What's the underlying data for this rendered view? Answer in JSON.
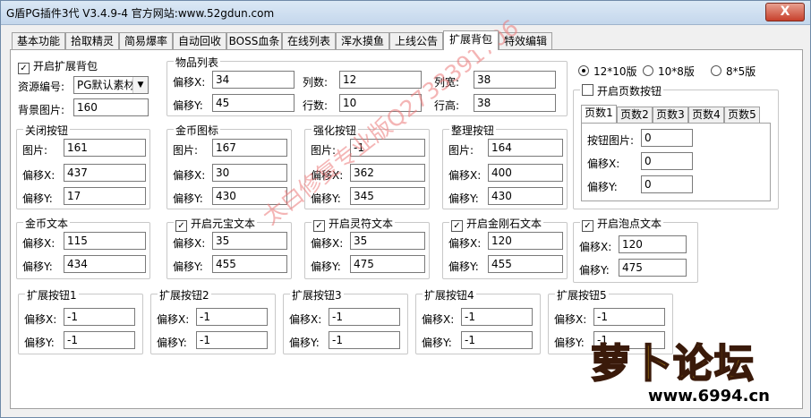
{
  "window": {
    "title": "G盾PG插件3代  V3.4.9-4   官方网站:www.52gdun.com",
    "close_label": "X"
  },
  "tabs": [
    "基本功能",
    "拾取精灵",
    "简易爆率",
    "自动回收",
    "BOSS血条",
    "在线列表",
    "浑水摸鱼",
    "上线公告",
    "扩展背包",
    "特效编辑"
  ],
  "active_tab": "扩展背包",
  "left": {
    "enable_label": "开启扩展背包",
    "enable_checked": true,
    "resource_label": "资源编号:",
    "resource_value": "PG默认素材",
    "bg_label": "背景图片:",
    "bg_value": "160"
  },
  "item_list": {
    "title": "物品列表",
    "offx_label": "偏移X:",
    "offx": "34",
    "offy_label": "偏移Y:",
    "offy": "45",
    "cols_label": "列数:",
    "cols": "12",
    "rows_label": "行数:",
    "rows": "10",
    "colw_label": "列宽:",
    "colw": "38",
    "rowh_label": "行高:",
    "rowh": "38"
  },
  "close_btn": {
    "title": "关闭按钮",
    "img_label": "图片:",
    "img": "161",
    "x_label": "偏移X:",
    "x": "437",
    "y_label": "偏移Y:",
    "y": "17"
  },
  "gold_icon": {
    "title": "金币图标",
    "img_label": "图片:",
    "img": "167",
    "x_label": "偏移X:",
    "x": "30",
    "y_label": "偏移Y:",
    "y": "430"
  },
  "strengthen_btn": {
    "title": "强化按钮",
    "img_label": "图片:",
    "img": "-1",
    "x_label": "偏移X:",
    "x": "362",
    "y_label": "偏移Y:",
    "y": "345"
  },
  "sort_btn": {
    "title": "整理按钮",
    "img_label": "图片:",
    "img": "164",
    "x_label": "偏移X:",
    "x": "400",
    "y_label": "偏移Y:",
    "y": "430"
  },
  "gold_text": {
    "title": "金币文本",
    "x_label": "偏移X:",
    "x": "115",
    "y_label": "偏移Y:",
    "y": "434"
  },
  "yuanbao_text": {
    "title": "开启元宝文本",
    "checked": true,
    "x_label": "偏移X:",
    "x": "35",
    "y_label": "偏移Y:",
    "y": "455"
  },
  "lingfu_text": {
    "title": "开启灵符文本",
    "checked": true,
    "x_label": "偏移X:",
    "x": "35",
    "y_label": "偏移Y:",
    "y": "475"
  },
  "diamond_text": {
    "title": "开启金刚石文本",
    "checked": true,
    "x_label": "偏移X:",
    "x": "120",
    "y_label": "偏移Y:",
    "y": "455"
  },
  "bubble_text": {
    "title": "开启泡点文本",
    "checked": true,
    "x_label": "偏移X:",
    "x": "120",
    "y_label": "偏移Y:",
    "y": "475"
  },
  "ext_buttons": [
    {
      "title": "扩展按钮1",
      "x_label": "偏移X:",
      "x": "-1",
      "y_label": "偏移Y:",
      "y": "-1"
    },
    {
      "title": "扩展按钮2",
      "x_label": "偏移X:",
      "x": "-1",
      "y_label": "偏移Y:",
      "y": "-1"
    },
    {
      "title": "扩展按钮3",
      "x_label": "偏移X:",
      "x": "-1",
      "y_label": "偏移Y:",
      "y": "-1"
    },
    {
      "title": "扩展按钮4",
      "x_label": "偏移X:",
      "x": "-1",
      "y_label": "偏移Y:",
      "y": "-1"
    },
    {
      "title": "扩展按钮5",
      "x_label": "偏移X:",
      "x": "-1",
      "y_label": "偏移Y:",
      "y": "-1"
    }
  ],
  "layouts": {
    "options": [
      "12*10版",
      "10*8版",
      "8*5版"
    ],
    "selected": "12*10版"
  },
  "page_nums": {
    "enable_label": "开启页数按钮",
    "enable_checked": false,
    "tabs": [
      "页数1",
      "页数2",
      "页数3",
      "页数4",
      "页数5"
    ],
    "active": "页数1",
    "img_label": "按钮图片:",
    "img": "0",
    "x_label": "偏移X:",
    "x": "0",
    "y_label": "偏移Y:",
    "y": "0"
  },
  "watermark": "太白修复专业版Q2733391706",
  "logo": {
    "text": "萝卜论坛",
    "url": "www.6994.cn"
  },
  "colors": {
    "titlebar": "#c4d7ec",
    "close": "#c7402c",
    "watermark": "#eb7878",
    "logo": "#ffd21a"
  }
}
